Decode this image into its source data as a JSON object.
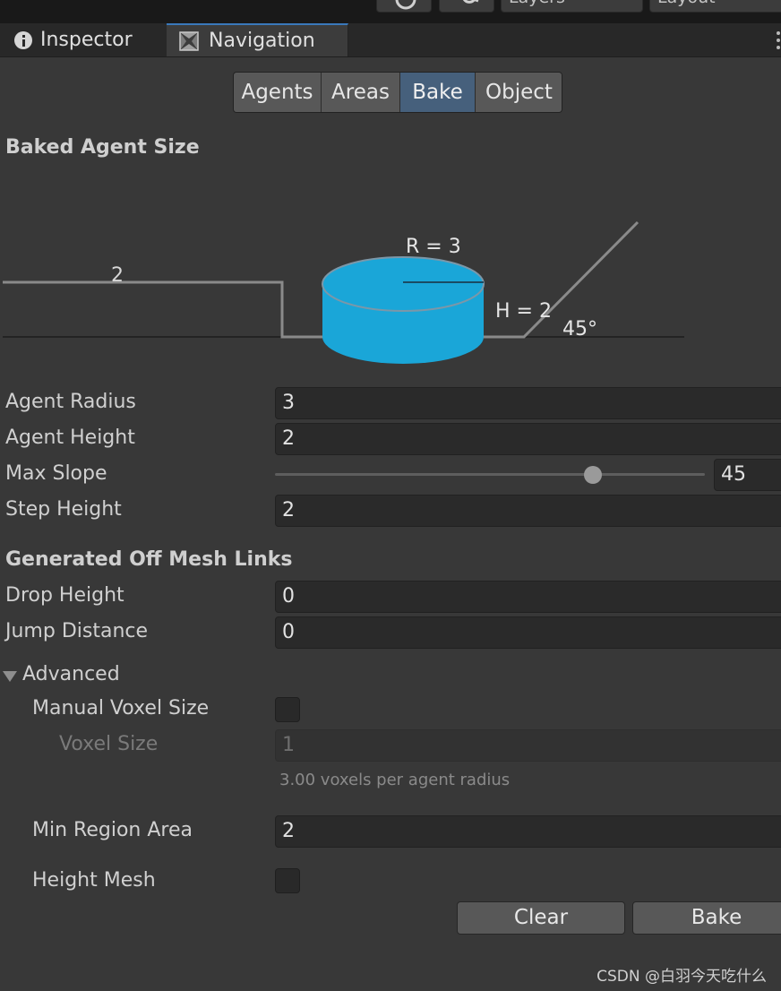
{
  "topbar": {
    "layers_label": "Layers",
    "layout_label": "Layout"
  },
  "tabs": {
    "inspector": "Inspector",
    "navigation": "Navigation"
  },
  "toolbar": {
    "agents": "Agents",
    "areas": "Areas",
    "bake": "Bake",
    "object": "Object",
    "active": "Bake"
  },
  "baked_agent": {
    "heading": "Baked Agent Size",
    "diagram": {
      "step_label": "2",
      "radius_label": "R = 3",
      "height_label": "H = 2",
      "slope_label": "45°",
      "cylinder_color": "#1aa6d8"
    }
  },
  "fields": {
    "agent_radius": {
      "label": "Agent Radius",
      "value": "3"
    },
    "agent_height": {
      "label": "Agent Height",
      "value": "2"
    },
    "max_slope": {
      "label": "Max Slope",
      "value": "45",
      "slider_fraction": 0.74
    },
    "step_height": {
      "label": "Step Height",
      "value": "2"
    }
  },
  "offmesh": {
    "heading": "Generated Off Mesh Links",
    "drop_height": {
      "label": "Drop Height",
      "value": "0"
    },
    "jump_distance": {
      "label": "Jump Distance",
      "value": "0"
    }
  },
  "advanced": {
    "label": "Advanced",
    "manual_voxel_size": {
      "label": "Manual Voxel Size",
      "checked": false
    },
    "voxel_size": {
      "label": "Voxel Size",
      "value": "1"
    },
    "voxel_note": "3.00 voxels per agent radius",
    "min_region_area": {
      "label": "Min Region Area",
      "value": "2"
    },
    "height_mesh": {
      "label": "Height Mesh",
      "checked": false
    }
  },
  "buttons": {
    "clear": "Clear",
    "bake": "Bake"
  },
  "watermark": "CSDN @白羽今天吃什么",
  "colors": {
    "accent": "#3a79bb",
    "active_tab": "#46607c",
    "background": "#383838"
  }
}
